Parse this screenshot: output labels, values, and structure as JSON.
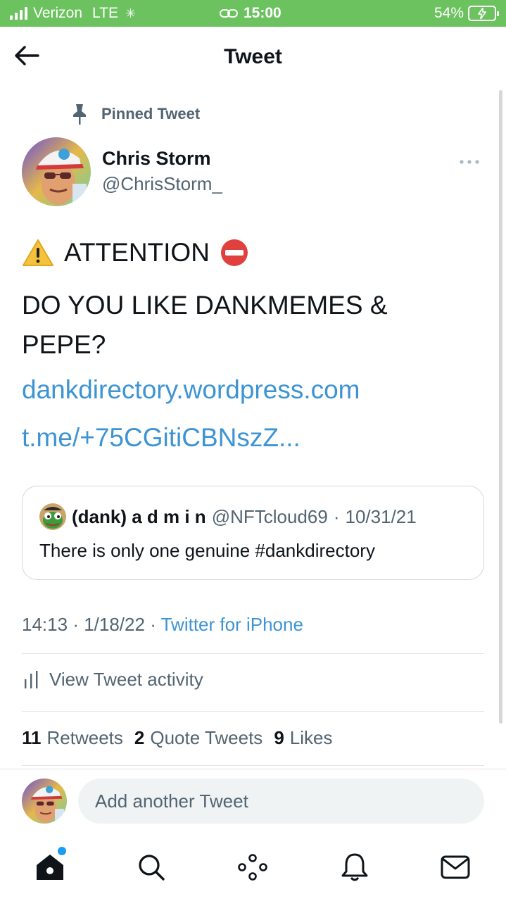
{
  "status_bar": {
    "carrier": "Verizon",
    "network": "LTE",
    "time": "15:00",
    "battery": "54%"
  },
  "header": {
    "title": "Tweet",
    "back_icon": "arrow-left-icon"
  },
  "tweet": {
    "pinned_label": "Pinned Tweet",
    "author": {
      "name": "Chris Storm",
      "handle": "@ChrisStorm_"
    },
    "attention": "ATTENTION",
    "question": "DO YOU LIKE DANKMEMES & PEPE?",
    "links": [
      "dankdirectory.wordpress.com",
      "t.me/+75CGitiCBNszZ..."
    ],
    "quote": {
      "name": "(dank) a d m i n",
      "handle": "@NFTcloud69",
      "date": "10/31/21",
      "text": "There is only one genuine #dankdirectory"
    },
    "time": "14:13",
    "date": "1/18/22",
    "source": "Twitter for iPhone",
    "activity_label": "View Tweet activity",
    "stats": {
      "retweets_count": "11",
      "retweets_label": "Retweets",
      "quotes_count": "2",
      "quotes_label": "Quote Tweets",
      "likes_count": "9",
      "likes_label": "Likes"
    }
  },
  "reply": {
    "placeholder": "Add another Tweet"
  },
  "nav": [
    "home-icon",
    "search-icon",
    "spaces-icon",
    "notifications-icon",
    "messages-icon"
  ],
  "colors": {
    "status_bar": "#6bc25f",
    "link": "#3d94d3",
    "secondary_text": "#536471"
  }
}
